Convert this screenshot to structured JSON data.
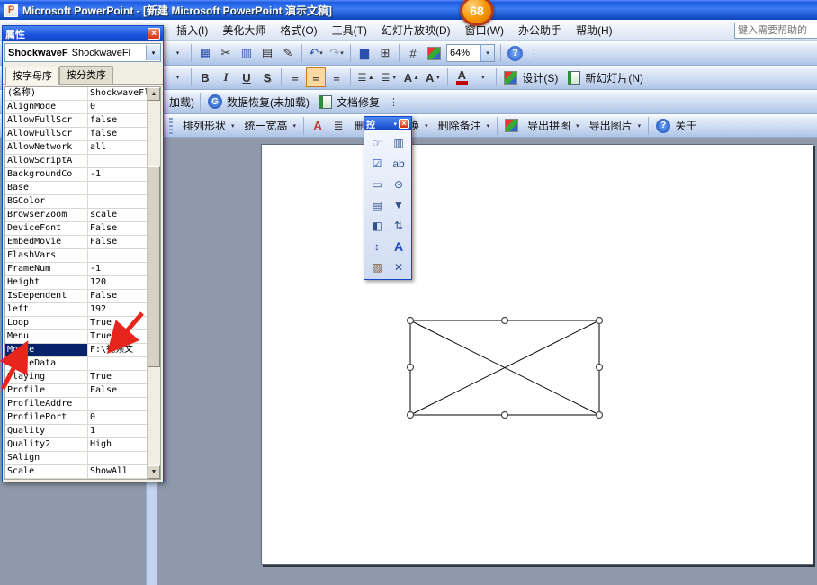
{
  "icons": {
    "dropdown": "▾",
    "close": "×",
    "up_arrow": "▲",
    "down_arrow": "▼",
    "overflow": "⋮"
  },
  "window": {
    "app_icon_glyph": "P",
    "title": "Microsoft PowerPoint - [新建 Microsoft PowerPoint 演示文稿]",
    "badge": "68"
  },
  "menu": {
    "items": [
      "插入(I)",
      "美化大师",
      "格式(O)",
      "工具(T)",
      "幻灯片放映(D)",
      "窗口(W)",
      "办公助手",
      "帮助(H)"
    ],
    "help_placeholder": "键入需要帮助的"
  },
  "standard_toolbar": {
    "zoom_value": "64%",
    "icons": {
      "combo_fragment": "▾",
      "insert_table": "▦",
      "cut": "✂",
      "copy": "▥",
      "paste": "▤",
      "format_painter": "✎",
      "undo": "↶",
      "redo": "↷",
      "chart": "▆",
      "datasheet": "⊞",
      "gridlines": "#",
      "help": "?"
    }
  },
  "formatting_toolbar": {
    "size_fragment": "▾",
    "bold": "B",
    "italic": "I",
    "underline": "U",
    "shadow": "S",
    "align_left": "≡",
    "align_center": "≡",
    "align_right": "≡",
    "spacing_a": "≣",
    "spacing_b": "≣",
    "grow_font": "A",
    "shrink_font": "A",
    "font_color": "A",
    "design_label": "设计(S)",
    "new_slide_label": "新幻灯片(N)"
  },
  "addin_toolbar": {
    "fragment": "加载)",
    "recovery_icon_glyph": "G",
    "recovery_label": "数据恢复(未加载)",
    "repair_label": "文档修复"
  },
  "tools_toolbar": {
    "items": [
      "排列形状",
      "统一宽高",
      "删除换页切换",
      "删除备注",
      "导出拼图",
      "导出图片"
    ],
    "about_label": "关于"
  },
  "properties_window": {
    "title": "属性",
    "object_name": "ShockwaveF",
    "object_class": "ShockwaveFl",
    "tab_alphabetic": "按字母序",
    "tab_categorized": "按分类序",
    "rows": [
      {
        "name": "(名称)",
        "value": "ShockwaveFl"
      },
      {
        "name": "AlignMode",
        "value": "0"
      },
      {
        "name": "AllowFullScr",
        "value": "false"
      },
      {
        "name": "AllowFullScr",
        "value": "false"
      },
      {
        "name": "AllowNetwork",
        "value": "all"
      },
      {
        "name": "AllowScriptA",
        "value": ""
      },
      {
        "name": "BackgroundCo",
        "value": "-1"
      },
      {
        "name": "Base",
        "value": ""
      },
      {
        "name": "BGColor",
        "value": ""
      },
      {
        "name": "BrowserZoom",
        "value": "scale"
      },
      {
        "name": "DeviceFont",
        "value": "False"
      },
      {
        "name": "EmbedMovie",
        "value": "False"
      },
      {
        "name": "FlashVars",
        "value": ""
      },
      {
        "name": "FrameNum",
        "value": "-1"
      },
      {
        "name": "Height",
        "value": "120"
      },
      {
        "name": "IsDependent",
        "value": "False"
      },
      {
        "name": "left",
        "value": "192"
      },
      {
        "name": "Loop",
        "value": "True"
      },
      {
        "name": "Menu",
        "value": "True"
      },
      {
        "name": "Movie",
        "value": "F:\\视频文",
        "selected": true
      },
      {
        "name": "MovieData",
        "value": ""
      },
      {
        "name": "Playing",
        "value": "True"
      },
      {
        "name": "Profile",
        "value": "False"
      },
      {
        "name": "ProfileAddre",
        "value": ""
      },
      {
        "name": "ProfilePort",
        "value": "0"
      },
      {
        "name": "Quality",
        "value": "1"
      },
      {
        "name": "Quality2",
        "value": "High"
      },
      {
        "name": "SAlign",
        "value": ""
      },
      {
        "name": "Scale",
        "value": "ShowAll"
      }
    ]
  },
  "control_toolbox": {
    "title": "控",
    "icons": [
      {
        "name": "properties-icon",
        "glyph": "☞"
      },
      {
        "name": "view-code-icon",
        "glyph": "▥"
      },
      {
        "name": "checkbox-icon",
        "glyph": "☑"
      },
      {
        "name": "textbox-icon",
        "glyph": "ab"
      },
      {
        "name": "command-button-icon",
        "glyph": "▭"
      },
      {
        "name": "option-button-icon",
        "glyph": "⊙"
      },
      {
        "name": "listbox-icon",
        "glyph": "▤"
      },
      {
        "name": "combobox-icon",
        "glyph": "▼"
      },
      {
        "name": "toggle-button-icon",
        "glyph": "◧"
      },
      {
        "name": "spin-button-icon",
        "glyph": "⇅"
      },
      {
        "name": "scrollbar-icon",
        "glyph": "↕"
      },
      {
        "name": "label-icon",
        "glyph": "A"
      },
      {
        "name": "image-icon",
        "glyph": "▨"
      },
      {
        "name": "more-controls-icon",
        "glyph": "✕"
      }
    ]
  },
  "colors": {
    "annotation_arrow": "#E8251D",
    "selection_navy": "#08216B",
    "titlebar_blue": "#1C5BE4",
    "badge_orange": "#F59300"
  }
}
